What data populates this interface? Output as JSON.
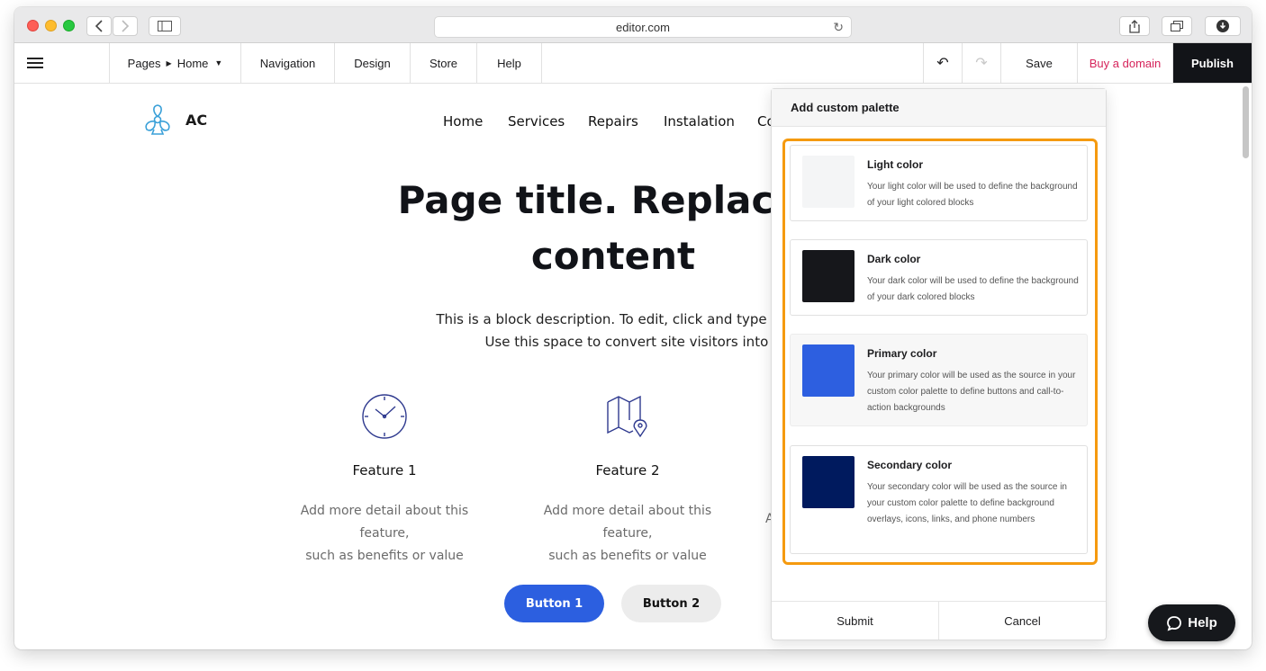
{
  "browser": {
    "url": "editor.com"
  },
  "toolbar": {
    "pages_label": "Pages",
    "current_page": "Home",
    "navigation": "Navigation",
    "design": "Design",
    "store": "Store",
    "help": "Help",
    "save": "Save",
    "buy_domain": "Buy a domain",
    "publish": "Publish"
  },
  "site": {
    "logo_text": "AC",
    "nav": [
      "Home",
      "Services",
      "Repairs",
      "Instalation",
      "Co"
    ],
    "hero_title_line1": "Page title. Replace it w",
    "hero_title_line2": "content",
    "hero_desc_line1": "This is a block description. To edit, click and type the text or replace",
    "hero_desc_line2": "Use this space to convert site visitors into customers wit",
    "features": [
      {
        "icon": "clock-icon",
        "title": "Feature 1",
        "desc1": "Add more detail about this feature,",
        "desc2": "such as benefits or value"
      },
      {
        "icon": "map-pin-icon",
        "title": "Feature 2",
        "desc1": "Add more detail about this feature,",
        "desc2": "such as benefits or value"
      }
    ],
    "feature3_partial": "A",
    "button1": "Button 1",
    "button2": "Button 2"
  },
  "palette_panel": {
    "title": "Add custom palette",
    "colors": [
      {
        "name": "Light color",
        "desc": "Your light color will be used to define the background of your light colored blocks",
        "hex": "#f4f5f6"
      },
      {
        "name": "Dark color",
        "desc": "Your dark color will be used to define the background of your dark colored blocks",
        "hex": "#16171b"
      },
      {
        "name": "Primary color",
        "desc": "Your primary color will be used as the source in your custom color palette to define buttons and call-to-action backgrounds",
        "hex": "#2d5fe0"
      },
      {
        "name": "Secondary color",
        "desc": "Your secondary color will be used as the source in your custom color palette to define background overlays, icons, links, and phone numbers",
        "hex": "#001a5e"
      }
    ],
    "submit": "Submit",
    "cancel": "Cancel"
  },
  "help_button": "Help",
  "colors": {
    "highlight": "#f59a0f",
    "publish_bg": "#121418",
    "buy_domain": "#d6245b",
    "button1": "#2c5fe0"
  }
}
